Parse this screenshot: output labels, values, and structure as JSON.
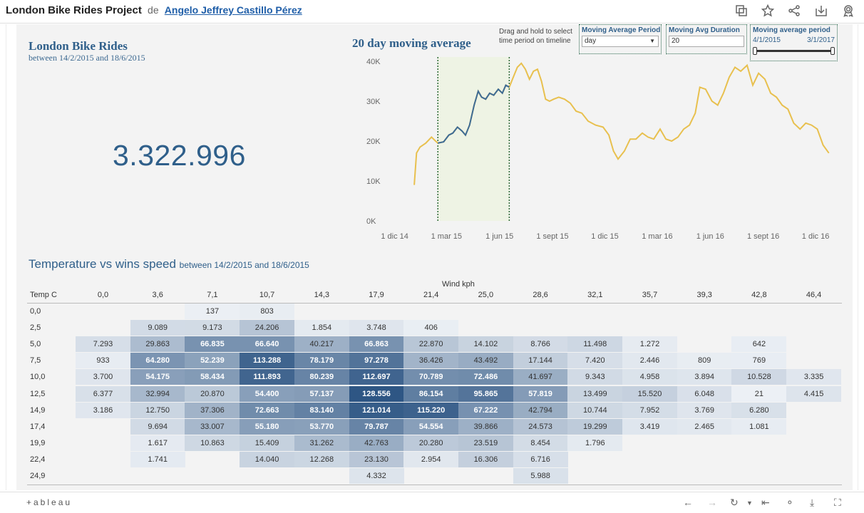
{
  "header": {
    "project_title": "London Bike Rides Project",
    "by_word": "de",
    "author": "Angelo Jeffrey Castillo Pérez",
    "icons": [
      "copy-icon",
      "star-icon",
      "share-icon",
      "download-icon",
      "badge-icon"
    ]
  },
  "kpi": {
    "title": "London Bike Rides",
    "subtitle": "between 14/2/2015 and 18/6/2015",
    "value": "3.322.996"
  },
  "moving_average": {
    "title": "20 day moving average",
    "drag_hint": "Drag and hold to select time period on timeline",
    "period_control": {
      "label": "Moving Average Period",
      "value": "day"
    },
    "duration_control": {
      "label": "Moving Avg Duration",
      "value": "20"
    },
    "range_control": {
      "label": "Moving average period",
      "start": "4/1/2015",
      "end": "3/1/2017"
    }
  },
  "chart_data": {
    "type": "line",
    "title": "20 day moving average",
    "x_ticks": [
      "1 dic 14",
      "1 mar 15",
      "1 jun 15",
      "1 sept 15",
      "1 dic 15",
      "1 mar 16",
      "1 jun 16",
      "1 sept 16",
      "1 dic 16"
    ],
    "y_ticks": [
      "0K",
      "10K",
      "20K",
      "30K",
      "40K"
    ],
    "ylim": [
      0,
      40000
    ],
    "x_range": [
      "2014-11-24",
      "2017-01-12"
    ],
    "selected_range": [
      "2015-02-14",
      "2015-06-18"
    ],
    "colors": {
      "line": "#e8c04e",
      "selected_line": "#3d6b96",
      "band": "#eef3e4",
      "band_edge": "#2e6a35"
    },
    "series": [
      {
        "points": [
          [
            "2015-01-04",
            9000
          ],
          [
            "2015-01-08",
            17000
          ],
          [
            "2015-01-14",
            18500
          ],
          [
            "2015-01-24",
            19500
          ],
          [
            "2015-02-03",
            21000
          ],
          [
            "2015-02-10",
            20000
          ],
          [
            "2015-02-14",
            19500
          ],
          [
            "2015-02-24",
            19800
          ],
          [
            "2015-03-05",
            21500
          ],
          [
            "2015-03-12",
            22000
          ],
          [
            "2015-03-20",
            23500
          ],
          [
            "2015-03-28",
            22500
          ],
          [
            "2015-04-03",
            21500
          ],
          [
            "2015-04-10",
            24000
          ],
          [
            "2015-04-18",
            29000
          ],
          [
            "2015-04-25",
            32500
          ],
          [
            "2015-05-01",
            31000
          ],
          [
            "2015-05-08",
            30500
          ],
          [
            "2015-05-15",
            32000
          ],
          [
            "2015-05-22",
            31500
          ],
          [
            "2015-05-30",
            33000
          ],
          [
            "2015-06-06",
            32000
          ],
          [
            "2015-06-12",
            34000
          ],
          [
            "2015-06-18",
            33500
          ],
          [
            "2015-06-25",
            36000
          ],
          [
            "2015-07-02",
            38500
          ],
          [
            "2015-07-09",
            39500
          ],
          [
            "2015-07-16",
            38000
          ],
          [
            "2015-07-23",
            35500
          ],
          [
            "2015-07-30",
            37500
          ],
          [
            "2015-08-06",
            38000
          ],
          [
            "2015-08-13",
            35000
          ],
          [
            "2015-08-20",
            30500
          ],
          [
            "2015-08-27",
            30000
          ],
          [
            "2015-09-03",
            30500
          ],
          [
            "2015-09-12",
            31000
          ],
          [
            "2015-09-22",
            30500
          ],
          [
            "2015-10-02",
            29500
          ],
          [
            "2015-10-12",
            27500
          ],
          [
            "2015-10-22",
            27000
          ],
          [
            "2015-11-02",
            25000
          ],
          [
            "2015-11-15",
            24000
          ],
          [
            "2015-11-28",
            23500
          ],
          [
            "2015-12-08",
            21500
          ],
          [
            "2015-12-16",
            17500
          ],
          [
            "2015-12-24",
            15500
          ],
          [
            "2016-01-04",
            17500
          ],
          [
            "2016-01-14",
            20500
          ],
          [
            "2016-01-24",
            20500
          ],
          [
            "2016-02-04",
            22000
          ],
          [
            "2016-02-14",
            21000
          ],
          [
            "2016-02-24",
            20500
          ],
          [
            "2016-03-06",
            23000
          ],
          [
            "2016-03-16",
            20500
          ],
          [
            "2016-03-26",
            20000
          ],
          [
            "2016-04-06",
            21000
          ],
          [
            "2016-04-16",
            23000
          ],
          [
            "2016-04-26",
            24000
          ],
          [
            "2016-05-06",
            27000
          ],
          [
            "2016-05-14",
            33500
          ],
          [
            "2016-05-24",
            33000
          ],
          [
            "2016-06-04",
            30000
          ],
          [
            "2016-06-14",
            29000
          ],
          [
            "2016-06-24",
            32000
          ],
          [
            "2016-07-04",
            36000
          ],
          [
            "2016-07-14",
            38500
          ],
          [
            "2016-07-24",
            37500
          ],
          [
            "2016-08-04",
            39000
          ],
          [
            "2016-08-14",
            34000
          ],
          [
            "2016-08-24",
            37000
          ],
          [
            "2016-09-04",
            35500
          ],
          [
            "2016-09-14",
            32000
          ],
          [
            "2016-09-24",
            31000
          ],
          [
            "2016-10-04",
            29000
          ],
          [
            "2016-10-14",
            28000
          ],
          [
            "2016-10-24",
            24500
          ],
          [
            "2016-11-04",
            23000
          ],
          [
            "2016-11-14",
            24500
          ],
          [
            "2016-11-24",
            24000
          ],
          [
            "2016-12-04",
            23000
          ],
          [
            "2016-12-14",
            19000
          ],
          [
            "2016-12-24",
            17000
          ]
        ]
      }
    ]
  },
  "heatmap": {
    "title": "Temperature vs wins speed",
    "subtitle": "between 14/2/2015 and 18/6/2015",
    "col_axis_label": "Wind kph",
    "row_axis_label": "Temp C",
    "columns": [
      "0,0",
      "3,6",
      "7,1",
      "10,7",
      "14,3",
      "17,9",
      "21,4",
      "25,0",
      "28,6",
      "32,1",
      "35,7",
      "39,3",
      "42,8",
      "46,4"
    ],
    "rows": [
      {
        "label": "0,0",
        "cells": [
          "",
          "",
          "137",
          "803",
          "",
          "",
          "",
          "",
          "",
          "",
          "",
          "",
          "",
          ""
        ]
      },
      {
        "label": "2,5",
        "cells": [
          "",
          "9.089",
          "9.173",
          "24.206",
          "1.854",
          "3.748",
          "406",
          "",
          "",
          "",
          "",
          "",
          "",
          ""
        ]
      },
      {
        "label": "5,0",
        "cells": [
          "7.293",
          "29.863",
          "66.835",
          "66.640",
          "40.217",
          "66.863",
          "22.870",
          "14.102",
          "8.766",
          "11.498",
          "1.272",
          "",
          "642",
          ""
        ]
      },
      {
        "label": "7,5",
        "cells": [
          "933",
          "64.280",
          "52.239",
          "113.288",
          "78.179",
          "97.278",
          "36.426",
          "43.492",
          "17.144",
          "7.420",
          "2.446",
          "809",
          "769",
          ""
        ]
      },
      {
        "label": "10,0",
        "cells": [
          "3.700",
          "54.175",
          "58.434",
          "111.893",
          "80.239",
          "112.697",
          "70.789",
          "72.486",
          "41.697",
          "9.343",
          "4.958",
          "3.894",
          "10.528",
          "3.335"
        ]
      },
      {
        "label": "12,5",
        "cells": [
          "6.377",
          "32.994",
          "20.870",
          "54.400",
          "57.137",
          "128.556",
          "86.154",
          "95.865",
          "57.819",
          "13.499",
          "15.520",
          "6.048",
          "21",
          "4.415"
        ]
      },
      {
        "label": "14,9",
        "cells": [
          "3.186",
          "12.750",
          "37.306",
          "72.663",
          "83.140",
          "121.014",
          "115.220",
          "67.222",
          "42.794",
          "10.744",
          "7.952",
          "3.769",
          "6.280",
          ""
        ]
      },
      {
        "label": "17,4",
        "cells": [
          "",
          "9.694",
          "33.007",
          "55.180",
          "53.770",
          "79.787",
          "54.554",
          "39.866",
          "24.573",
          "19.299",
          "3.419",
          "2.465",
          "1.081",
          ""
        ]
      },
      {
        "label": "19,9",
        "cells": [
          "",
          "1.617",
          "10.863",
          "15.409",
          "31.262",
          "42.763",
          "20.280",
          "23.519",
          "8.454",
          "1.796",
          "",
          "",
          "",
          ""
        ]
      },
      {
        "label": "22,4",
        "cells": [
          "",
          "1.741",
          "",
          "14.040",
          "12.268",
          "23.130",
          "2.954",
          "16.306",
          "6.716",
          "",
          "",
          "",
          "",
          ""
        ]
      },
      {
        "label": "24,9",
        "cells": [
          "",
          "",
          "",
          "",
          "",
          "4.332",
          "",
          "",
          "5.988",
          "",
          "",
          "",
          "",
          ""
        ]
      }
    ]
  },
  "footer": {
    "logo": "+ableau",
    "icons": [
      "undo-icon",
      "redo-icon",
      "revert-icon",
      "reset-icon",
      "share-icon",
      "download-icon",
      "fullscreen-icon"
    ]
  }
}
